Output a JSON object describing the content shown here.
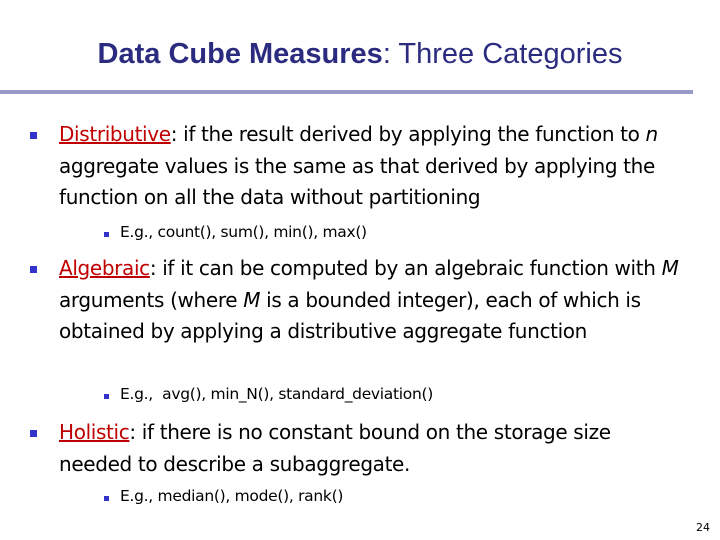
{
  "slide": {
    "title_bold": "Data Cube Measures",
    "title_rest": ": Three Categories",
    "page_number": "24",
    "items": [
      {
        "term": "Distributive",
        "text_a": ": if the result derived by applying the function to ",
        "var": "n",
        "text_b": " aggregate values is the same as that derived by applying the function on all the data without partitioning",
        "example": "E.g., count(), sum(), min(), max()"
      },
      {
        "term": "Algebraic",
        "text_a": ": if it can be computed by an algebraic function with ",
        "var": "M",
        "text_mid": " arguments (where ",
        "var2": "M",
        "text_b": " is a bounded integer), each of which is obtained by applying a distributive aggregate function",
        "example": "E.g.,  avg(), min_N(), standard_deviation()"
      },
      {
        "term": "Holistic",
        "text_a": ": if there is no constant bound on the storage size needed to describe a subaggregate.",
        "example": "E.g., median(), mode(), rank()"
      }
    ]
  }
}
